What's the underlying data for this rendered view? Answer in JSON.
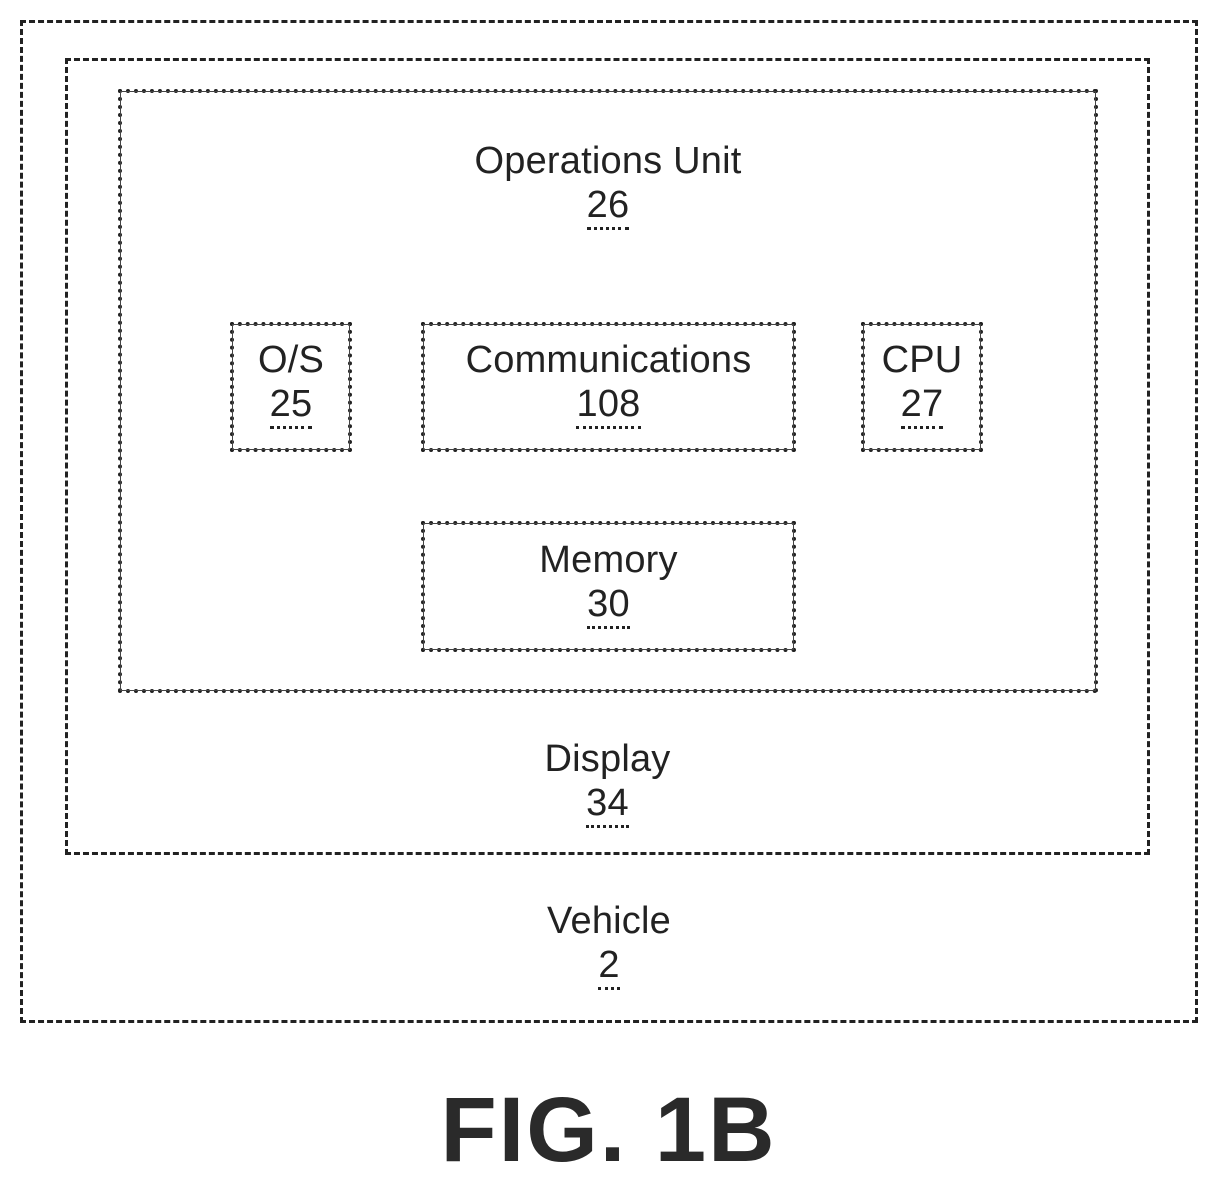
{
  "diagram": {
    "vehicle": {
      "title": "Vehicle",
      "ref": "2"
    },
    "display": {
      "title": "Display",
      "ref": "34"
    },
    "operations_unit": {
      "title": "Operations Unit",
      "ref": "26"
    },
    "os": {
      "title": "O/S",
      "ref": "25"
    },
    "communications": {
      "title": "Communications",
      "ref": "108"
    },
    "cpu": {
      "title": "CPU",
      "ref": "27"
    },
    "memory": {
      "title": "Memory",
      "ref": "30"
    }
  },
  "figure_label": "FIG. 1B"
}
